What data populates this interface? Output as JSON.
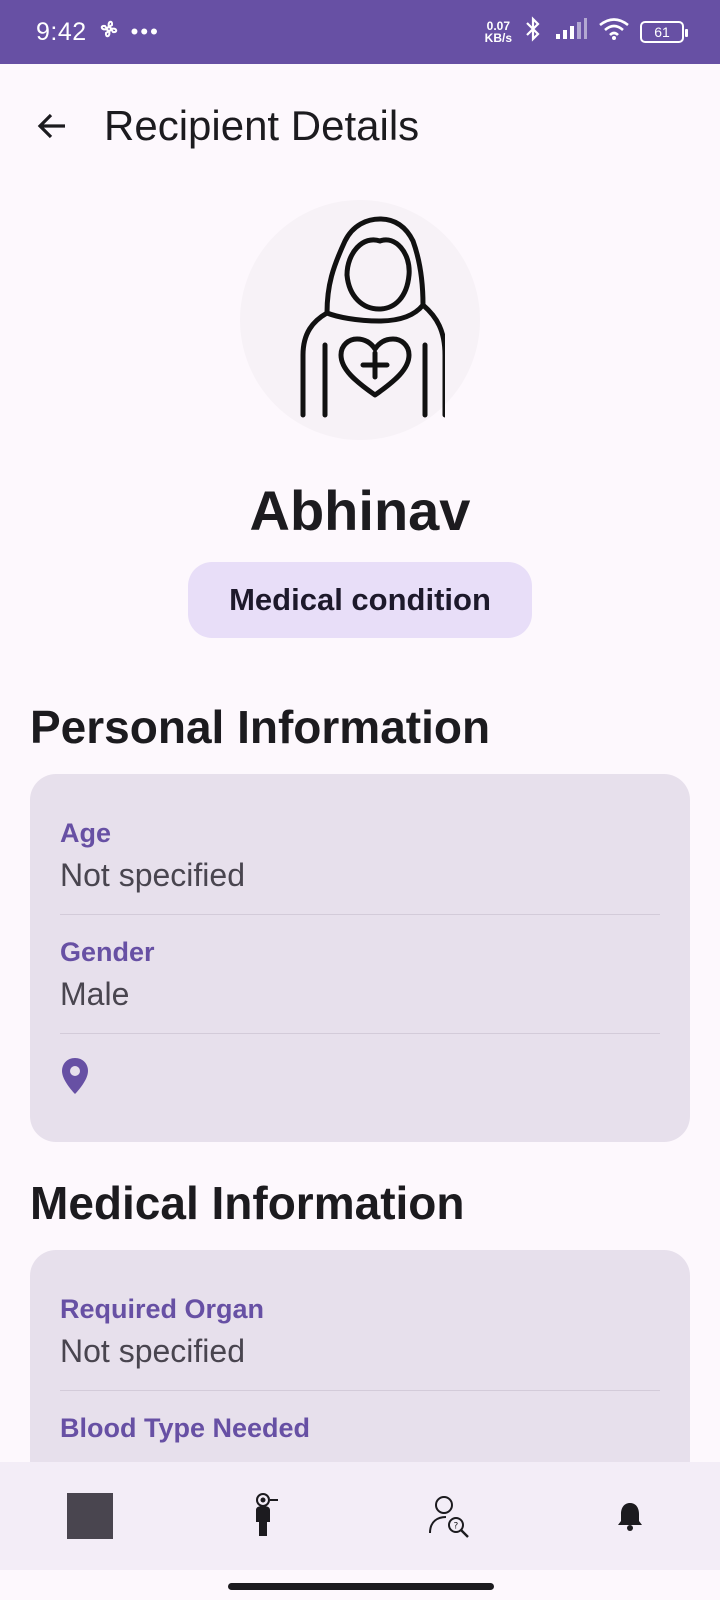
{
  "status": {
    "time": "9:42",
    "netspeed_value": "0.07",
    "netspeed_unit": "KB/s",
    "battery": "61"
  },
  "header": {
    "title": "Recipient Details"
  },
  "profile": {
    "name": "Abhinav",
    "chip": "Medical condition"
  },
  "personal": {
    "title": "Personal Information",
    "age_label": "Age",
    "age_value": "Not specified",
    "gender_label": "Gender",
    "gender_value": "Male"
  },
  "medical": {
    "title": "Medical Information",
    "organ_label": "Required Organ",
    "organ_value": "Not specified",
    "blood_label": "Blood Type Needed"
  },
  "colors": {
    "accent": "#6750a4",
    "chip_bg": "#e8def8",
    "card_bg": "#e7e0ec"
  },
  "icons": [
    "back-arrow-icon",
    "recipient-avatar-icon",
    "location-pin-icon",
    "home-nav-icon",
    "donor-nav-icon",
    "search-person-nav-icon",
    "notification-nav-icon"
  ]
}
